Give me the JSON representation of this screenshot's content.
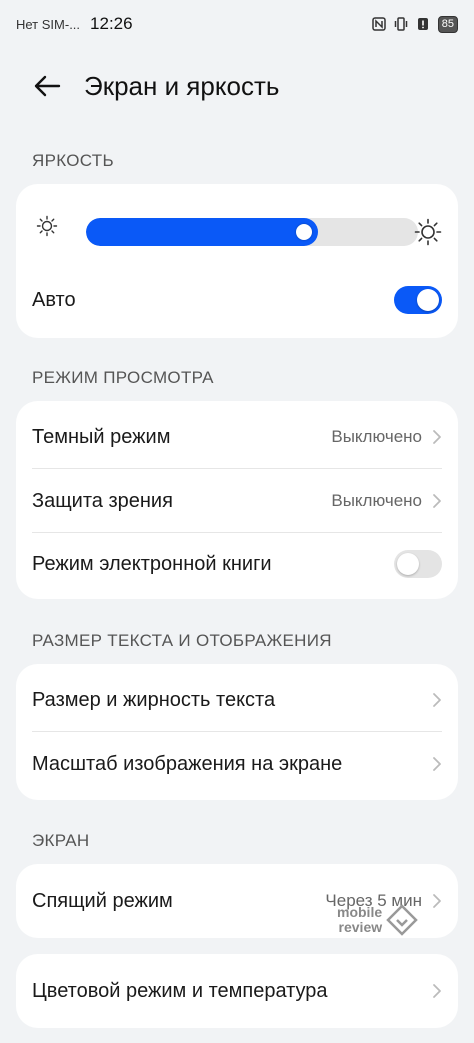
{
  "status_bar": {
    "sim": "Нет SIM-...",
    "time": "12:26",
    "battery": "85"
  },
  "header": {
    "title": "Экран и яркость"
  },
  "brightness": {
    "section_label": "ЯРКОСТЬ",
    "level_percent": 70,
    "auto_label": "Авто",
    "auto_enabled": true
  },
  "view_mode": {
    "section_label": "РЕЖИМ ПРОСМОТРА",
    "dark_mode": {
      "label": "Темный режим",
      "value": "Выключено"
    },
    "eye_comfort": {
      "label": "Защита зрения",
      "value": "Выключено"
    },
    "ebook_mode": {
      "label": "Режим электронной книги",
      "enabled": false
    }
  },
  "text_display": {
    "section_label": "РАЗМЕР ТЕКСТА И ОТОБРАЖЕНИЯ",
    "text_size": {
      "label": "Размер и жирность текста"
    },
    "display_scale": {
      "label": "Масштаб изображения на экране"
    }
  },
  "screen": {
    "section_label": "ЭКРАН",
    "sleep": {
      "label": "Спящий режим",
      "value": "Через 5 мин"
    },
    "color_mode": {
      "label": "Цветовой режим и температура"
    }
  },
  "watermark": {
    "line1": "mobile",
    "line2": "review"
  },
  "colors": {
    "accent": "#0a59f7",
    "background": "#f1f3f5",
    "card": "#ffffff"
  }
}
